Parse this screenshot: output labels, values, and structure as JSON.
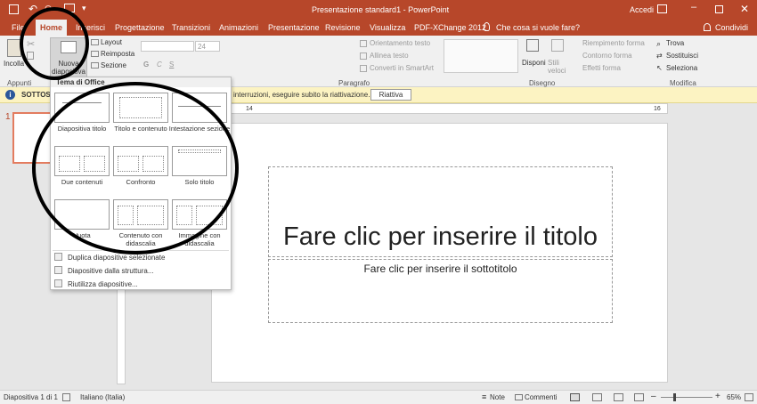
{
  "window": {
    "title": "Presentazione standard1 - PowerPoint",
    "signin": "Accedi"
  },
  "tabs": [
    {
      "label": "File"
    },
    {
      "label": "Home"
    },
    {
      "label": "Inserisci"
    },
    {
      "label": "Progettazione"
    },
    {
      "label": "Transizioni"
    },
    {
      "label": "Animazioni"
    },
    {
      "label": "Presentazione"
    },
    {
      "label": "Revisione"
    },
    {
      "label": "Visualizza"
    },
    {
      "label": "PDF-XChange 2012"
    }
  ],
  "tellme": "Che cosa si vuole fare?",
  "share": "Condividi",
  "ribbon": {
    "paste": "Incolla",
    "new_slide": "Nuova diapositiva",
    "layout": "Layout",
    "reset": "Reimposta",
    "section": "Sezione",
    "font_size": "24",
    "text_direction": "Orientamento testo",
    "align_text": "Allinea testo",
    "smartart": "Converti in SmartArt",
    "arrange": "Disponi",
    "quick_styles": "Stili veloci",
    "shape_fill": "Riempimento forma",
    "shape_outline": "Contorno forma",
    "shape_effects": "Effetti forma",
    "find": "Trova",
    "replace": "Sostituisci",
    "select": "Seleziona",
    "groups": {
      "clipboard": "Appunti",
      "paragraph": "Paragrafo",
      "drawing": "Disegno",
      "editing": "Modifica"
    }
  },
  "infobar": {
    "label": "SOTTOSC",
    "message": "interruzioni, eseguire subito la riattivazione.",
    "button": "Riattiva"
  },
  "dropdown": {
    "header": "Tema di Office",
    "layouts": [
      {
        "label": "Diapositiva titolo"
      },
      {
        "label": "Titolo e contenuto"
      },
      {
        "label": "Intestazione sezione"
      },
      {
        "label": "Due contenuti"
      },
      {
        "label": "Confronto"
      },
      {
        "label": "Solo titolo"
      },
      {
        "label": "Vuota"
      },
      {
        "label": "Contenuto con didascalia"
      },
      {
        "label": "Immagine con didascalia"
      }
    ],
    "menu": [
      {
        "label": "Duplica diapositive selezionate"
      },
      {
        "label": "Diapositive dalla struttura..."
      },
      {
        "label": "Riutilizza diapositive..."
      }
    ]
  },
  "thumbnail_number": "1",
  "ruler": {
    "left": "14",
    "right": "16"
  },
  "slide": {
    "title": "Fare clic per inserire il titolo",
    "subtitle": "Fare clic per inserire il sottotitolo"
  },
  "status": {
    "slide": "Diapositiva 1 di 1",
    "language": "Italiano (Italia)",
    "notes": "Note",
    "comments": "Commenti",
    "zoom": "65%"
  },
  "colors": {
    "accent": "#b7472a",
    "infobar": "#fcf3c2"
  }
}
